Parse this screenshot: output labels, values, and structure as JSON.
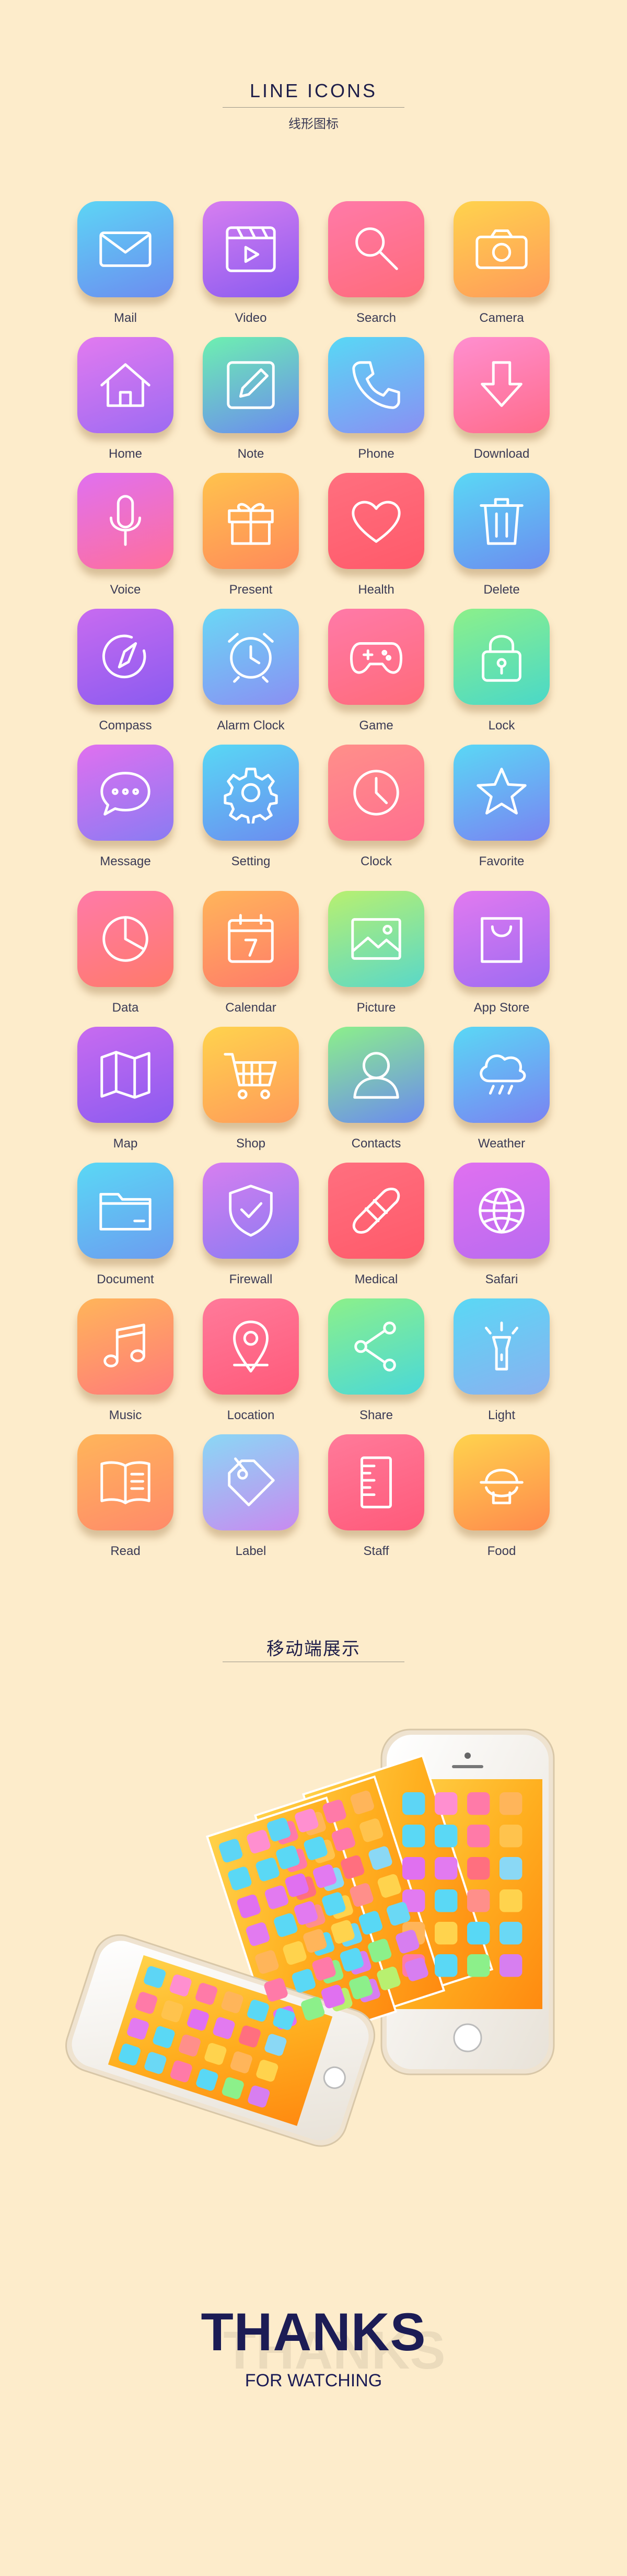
{
  "header": {
    "title": "LINE  ICONS",
    "subtitle": "线形图标"
  },
  "icons": [
    {
      "label": "Mail",
      "icon": "mail-icon",
      "g": [
        "#5dd5f5",
        "#6c8cf0"
      ]
    },
    {
      "label": "Video",
      "icon": "video-icon",
      "g": [
        "#d77ef0",
        "#8a5bf0"
      ]
    },
    {
      "label": "Search",
      "icon": "search-icon",
      "g": [
        "#ff7aa8",
        "#ff6b7a"
      ]
    },
    {
      "label": "Camera",
      "icon": "camera-icon",
      "g": [
        "#ffd34d",
        "#ff9a5a"
      ]
    },
    {
      "label": "Home",
      "icon": "home-icon",
      "g": [
        "#e27af0",
        "#9d6bf2"
      ]
    },
    {
      "label": "Note",
      "icon": "note-icon",
      "g": [
        "#6df0b0",
        "#6b8af0"
      ]
    },
    {
      "label": "Phone",
      "icon": "phone-icon",
      "g": [
        "#58d8f5",
        "#8a8ff3"
      ]
    },
    {
      "label": "Download",
      "icon": "download-icon",
      "g": [
        "#ff8fd0",
        "#ff6b8a"
      ]
    },
    {
      "label": "Voice",
      "icon": "voice-icon",
      "g": [
        "#e070f0",
        "#ff6f9b"
      ]
    },
    {
      "label": "Present",
      "icon": "present-icon",
      "g": [
        "#ffc34d",
        "#ff8a5a"
      ]
    },
    {
      "label": "Health",
      "icon": "health-icon",
      "g": [
        "#ff6f7f",
        "#ff5a6a"
      ]
    },
    {
      "label": "Delete",
      "icon": "delete-icon",
      "g": [
        "#5ad8f5",
        "#6c8cf0"
      ]
    },
    {
      "label": "Compass",
      "icon": "compass-icon",
      "g": [
        "#c86bf0",
        "#8a5bf0"
      ]
    },
    {
      "label": "Alarm Clock",
      "icon": "alarm-clock-icon",
      "g": [
        "#6ad8f5",
        "#8a8ff3"
      ]
    },
    {
      "label": "Game",
      "icon": "game-icon",
      "g": [
        "#ff7aa8",
        "#ff6b7a"
      ]
    },
    {
      "label": "Lock",
      "icon": "lock-icon",
      "g": [
        "#8cf08a",
        "#4ad8c8"
      ]
    },
    {
      "label": "Message",
      "icon": "message-icon",
      "g": [
        "#e070f0",
        "#8a7bf2"
      ]
    },
    {
      "label": "Setting",
      "icon": "setting-icon",
      "g": [
        "#58d8f5",
        "#6c8cf0"
      ]
    },
    {
      "label": "Clock",
      "icon": "clock-icon",
      "g": [
        "#ff8f8a",
        "#ff6f8f"
      ]
    },
    {
      "label": "Favorite",
      "icon": "favorite-icon",
      "g": [
        "#5ad8f5",
        "#7a82f2"
      ]
    },
    {
      "label": "Data",
      "icon": "data-icon",
      "g": [
        "#ff7aa8",
        "#ff7a6a"
      ]
    },
    {
      "label": "Calendar",
      "icon": "calendar-icon",
      "g": [
        "#ffb55a",
        "#ff7a6a"
      ]
    },
    {
      "label": "Picture",
      "icon": "picture-icon",
      "g": [
        "#b8f070",
        "#5ad8c8"
      ]
    },
    {
      "label": "App Store",
      "icon": "app-store-icon",
      "g": [
        "#e27af0",
        "#9d6bf2"
      ]
    },
    {
      "label": "Map",
      "icon": "map-icon",
      "g": [
        "#c86bf0",
        "#8a5bf0"
      ]
    },
    {
      "label": "Shop",
      "icon": "shop-icon",
      "g": [
        "#ffd34d",
        "#ff9a5a"
      ]
    },
    {
      "label": "Contacts",
      "icon": "contacts-icon",
      "g": [
        "#8cf08a",
        "#6b8af0"
      ]
    },
    {
      "label": "Weather",
      "icon": "weather-icon",
      "g": [
        "#5ad8f5",
        "#7a82f2"
      ]
    },
    {
      "label": "Document",
      "icon": "document-icon",
      "g": [
        "#5ad8f5",
        "#6c9cf0"
      ]
    },
    {
      "label": "Firewall",
      "icon": "firewall-icon",
      "g": [
        "#d77ef0",
        "#8a7bf2"
      ]
    },
    {
      "label": "Medical",
      "icon": "medical-icon",
      "g": [
        "#ff6f7f",
        "#ff5a6a"
      ]
    },
    {
      "label": "Safari",
      "icon": "safari-icon",
      "g": [
        "#e070f0",
        "#b86bf0"
      ]
    },
    {
      "label": "Music",
      "icon": "music-icon",
      "g": [
        "#ffb55a",
        "#ff7a7a"
      ]
    },
    {
      "label": "Location",
      "icon": "location-icon",
      "g": [
        "#ff7a9a",
        "#ff5a7a"
      ]
    },
    {
      "label": "Share",
      "icon": "share-icon",
      "g": [
        "#8cf08a",
        "#4ad8d8"
      ]
    },
    {
      "label": "Light",
      "icon": "light-icon",
      "g": [
        "#5ad8f5",
        "#8ab0f0"
      ]
    },
    {
      "label": "Read",
      "icon": "read-icon",
      "g": [
        "#ffb55a",
        "#ff8a6a"
      ]
    },
    {
      "label": "Label",
      "icon": "label-icon",
      "g": [
        "#8ad8f5",
        "#c88af0"
      ]
    },
    {
      "label": "Staff",
      "icon": "staff-icon",
      "g": [
        "#ff7a9a",
        "#ff5a7a"
      ]
    },
    {
      "label": "Food",
      "icon": "food-icon",
      "g": [
        "#ffd34d",
        "#ff8a4d"
      ]
    }
  ],
  "mobile_section": {
    "title": "移动端展示"
  },
  "thanks": {
    "title": "THANKS",
    "subtitle": "FOR WATCHING"
  }
}
